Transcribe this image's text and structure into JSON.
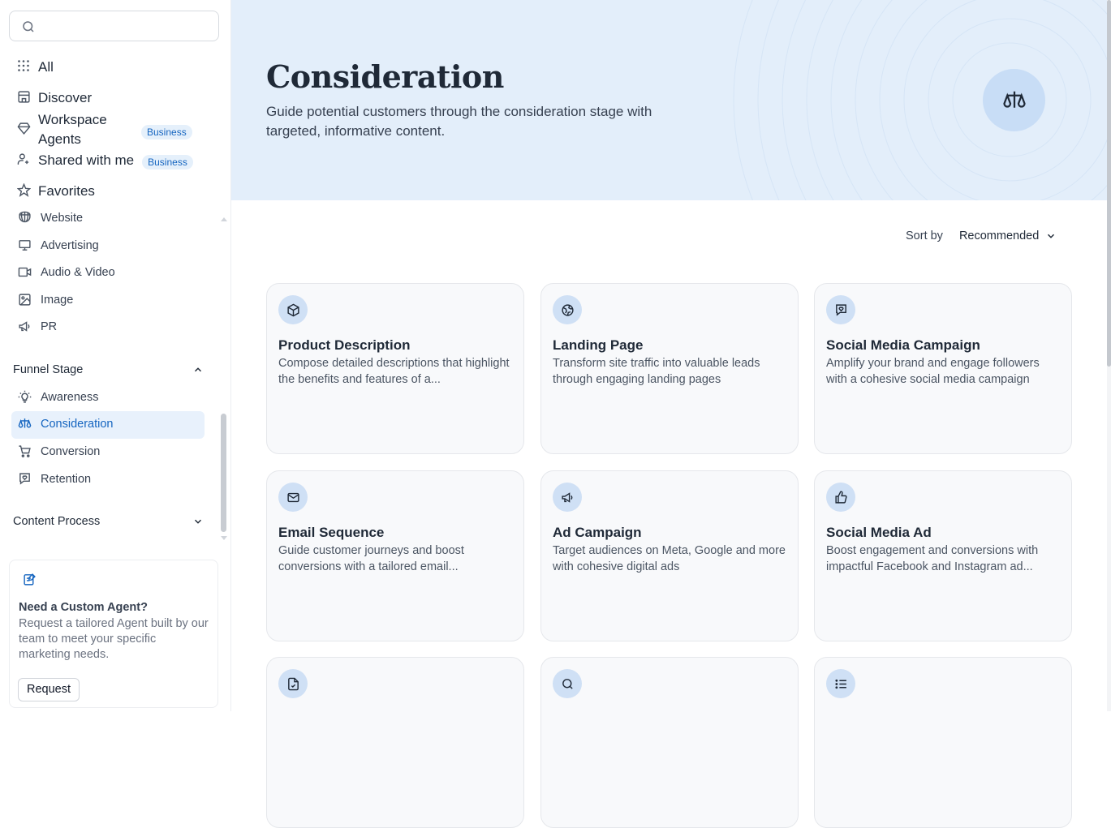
{
  "search": {
    "placeholder": ""
  },
  "nav": {
    "all": "All",
    "discover": "Discover",
    "workspace_agents": "Workspace Agents",
    "workspace_badge": "Business",
    "shared": "Shared with me",
    "shared_badge": "Business",
    "favorites": "Favorites"
  },
  "categories": [
    {
      "label": "Website",
      "icon": "globe-icon"
    },
    {
      "label": "Advertising",
      "icon": "monitor-icon"
    },
    {
      "label": "Audio & Video",
      "icon": "video-icon"
    },
    {
      "label": "Image",
      "icon": "image-icon"
    },
    {
      "label": "PR",
      "icon": "megaphone-icon"
    }
  ],
  "funnel": {
    "header": "Funnel Stage",
    "items": [
      {
        "label": "Awareness",
        "icon": "lightbulb-icon"
      },
      {
        "label": "Consideration",
        "icon": "scale-icon",
        "active": true
      },
      {
        "label": "Conversion",
        "icon": "cart-icon"
      },
      {
        "label": "Retention",
        "icon": "heart-message-icon"
      }
    ]
  },
  "content_process": {
    "header": "Content Process"
  },
  "custom_agent": {
    "title": "Need a Custom Agent?",
    "description": "Request a tailored Agent built by our team to meet your specific marketing needs.",
    "button": "Request"
  },
  "hero": {
    "title": "Consideration",
    "description": "Guide potential customers through the consideration stage with targeted, informative content."
  },
  "sort": {
    "label": "Sort by",
    "value": "Recommended"
  },
  "cards": [
    {
      "title": "Product Description",
      "description": "Compose detailed descriptions that highlight the benefits and features of a...",
      "icon": "box-icon"
    },
    {
      "title": "Landing Page",
      "description": "Transform site traffic into valuable leads through engaging landing pages",
      "icon": "globe-icon"
    },
    {
      "title": "Social Media Campaign",
      "description": "Amplify your brand and engage followers with a cohesive social media campaign",
      "icon": "heart-message-icon"
    },
    {
      "title": "Email Sequence",
      "description": "Guide customer journeys and boost conversions with a tailored email...",
      "icon": "mail-icon"
    },
    {
      "title": "Ad Campaign",
      "description": "Target audiences on Meta, Google and more with cohesive digital ads",
      "icon": "megaphone-icon"
    },
    {
      "title": "Social Media Ad",
      "description": "Boost engagement and conversions with impactful Facebook and Instagram ad...",
      "icon": "thumbs-up-icon"
    },
    {
      "title": "",
      "description": "",
      "icon": "file-check-icon"
    },
    {
      "title": "",
      "description": "",
      "icon": "search-icon"
    },
    {
      "title": "",
      "description": "",
      "icon": "list-icon"
    }
  ],
  "colors": {
    "accent": "#1565c0",
    "hero_bg": "#e3eefa",
    "active_bg": "#e8f1fc",
    "card_bg": "#f8f9fb"
  }
}
